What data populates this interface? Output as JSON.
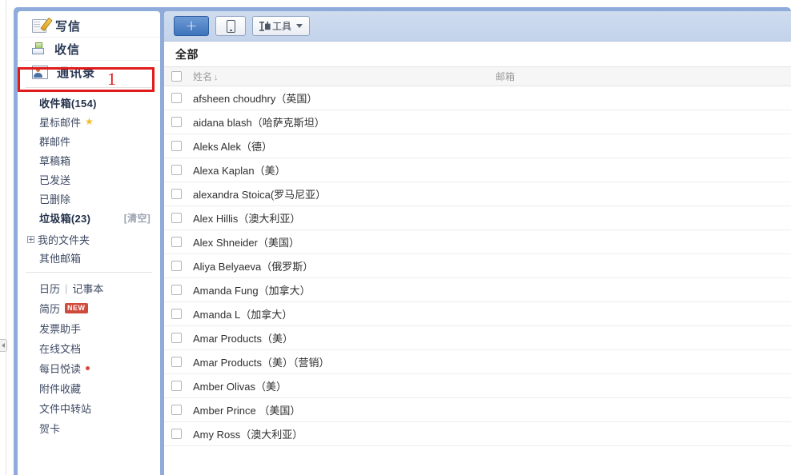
{
  "sidebar": {
    "main_nav": [
      {
        "label": "写信",
        "icon": "write-icon"
      },
      {
        "label": "收信",
        "icon": "receive-icon"
      },
      {
        "label": "通讯录",
        "icon": "contacts-icon"
      }
    ],
    "folders": [
      {
        "label": "收件箱(154)",
        "bold": true,
        "star": false,
        "aux": ""
      },
      {
        "label": "星标邮件",
        "bold": false,
        "star": true,
        "aux": ""
      },
      {
        "label": "群邮件",
        "bold": false,
        "star": false,
        "aux": ""
      },
      {
        "label": "草稿箱",
        "bold": false,
        "star": false,
        "aux": ""
      },
      {
        "label": "已发送",
        "bold": false,
        "star": false,
        "aux": ""
      },
      {
        "label": "已删除",
        "bold": false,
        "star": false,
        "aux": ""
      },
      {
        "label": "垃圾箱(23)",
        "bold": true,
        "star": false,
        "aux": "[清空]"
      }
    ],
    "my_folder": {
      "label": "我的文件夹",
      "toggle": "+"
    },
    "other_mailbox": {
      "label": "其他邮箱"
    },
    "tools": {
      "calendar": "日历",
      "separator": "|",
      "notes": "记事本",
      "resume": "简历",
      "resume_badge": "NEW",
      "invoice_helper": "发票助手",
      "online_doc": "在线文档",
      "daily_read": "每日悦读",
      "attachment_fav": "附件收藏",
      "file_transfer": "文件中转站",
      "greeting_card": "贺卡"
    }
  },
  "annotation": {
    "number": "1",
    "color": "#e01b1b",
    "target": "通讯录"
  },
  "toolbar": {
    "add_label": "+",
    "mobile_icon": "mobile-phone-icon",
    "tools_label": "工具",
    "tools_icon": "tools-icon",
    "caret_icon": "chevron-down-icon"
  },
  "main": {
    "section_title": "全部",
    "columns": {
      "name": "姓名",
      "sort_mark": "↓",
      "email": "邮箱"
    },
    "contacts": [
      {
        "name": "afsheen choudhry（英国）",
        "email": ""
      },
      {
        "name": "aidana blash（哈萨克斯坦）",
        "email": ""
      },
      {
        "name": "Aleks Alek（德）",
        "email": ""
      },
      {
        "name": " Alexa Kaplan（美）",
        "email": ""
      },
      {
        "name": "alexandra Stoica(罗马尼亚）",
        "email": ""
      },
      {
        "name": "Alex Hillis（澳大利亚）",
        "email": ""
      },
      {
        "name": "Alex Shneider（美国）",
        "email": ""
      },
      {
        "name": "Aliya Belyaeva（俄罗斯）",
        "email": ""
      },
      {
        "name": "Amanda Fung（加拿大）",
        "email": ""
      },
      {
        "name": "Amanda L（加拿大）",
        "email": ""
      },
      {
        "name": "Amar Products（美）",
        "email": ""
      },
      {
        "name": "Amar Products（美）（营销）",
        "email": ""
      },
      {
        "name": " Amber Olivas（美）",
        "email": ""
      },
      {
        "name": "Amber Prince  （美国）",
        "email": ""
      },
      {
        "name": "Amy Ross（澳大利亚）",
        "email": ""
      }
    ]
  },
  "colors": {
    "frame_blue": "#8fabd9",
    "toolbar_blue": "#c8d8ee",
    "accent_red": "#e01b1b",
    "badge_red": "#d04a3c",
    "nav_text": "#2b3a55"
  }
}
